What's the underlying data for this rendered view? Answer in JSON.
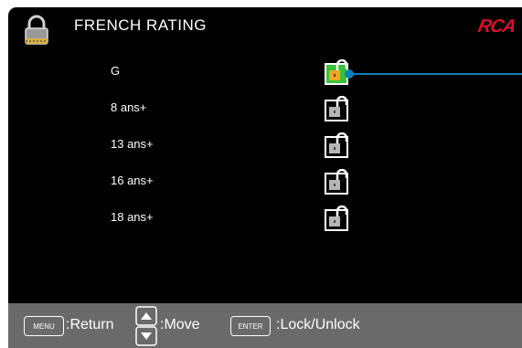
{
  "header": {
    "title": "FRENCH RATING",
    "logo": "RCA",
    "icon": "padlock-icon"
  },
  "ratings": [
    {
      "label": "G",
      "state": "unlocked",
      "selected": true
    },
    {
      "label": "8 ans+",
      "state": "unlocked",
      "selected": false
    },
    {
      "label": "13 ans+",
      "state": "unlocked",
      "selected": false
    },
    {
      "label": "16 ans+",
      "state": "unlocked",
      "selected": false
    },
    {
      "label": "18 ans+",
      "state": "unlocked",
      "selected": false
    }
  ],
  "footer": {
    "menu_key": "MENU",
    "menu_action": ":Return",
    "move_action": ":Move",
    "enter_key": "ENTER",
    "enter_action": ":Lock/Unlock"
  },
  "colors": {
    "background": "#000000",
    "footer": "#6a6a6a",
    "accent": "#0a7fb8",
    "selected_lock": "#39c23a",
    "logo": "#d8102a"
  }
}
